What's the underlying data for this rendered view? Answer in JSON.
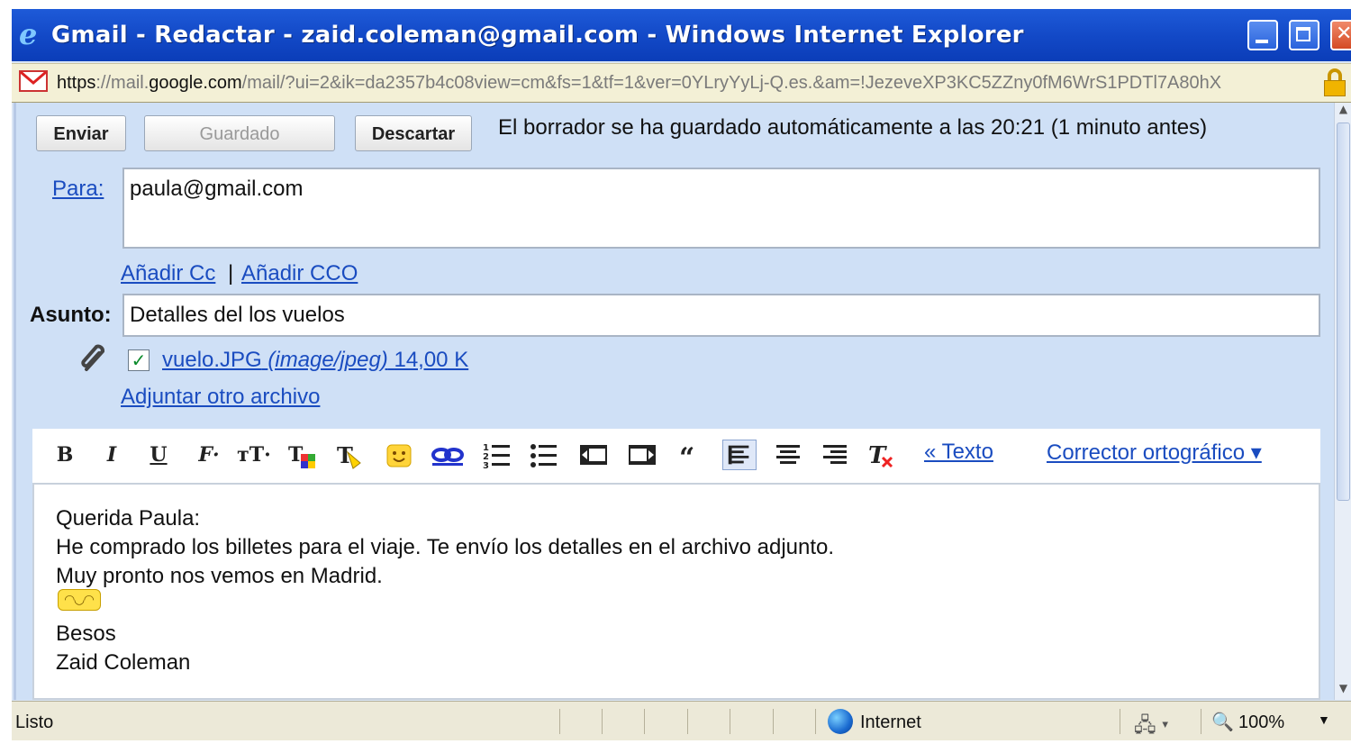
{
  "window": {
    "title": "Gmail - Redactar - zaid.coleman@gmail.com - Windows Internet Explorer",
    "icon": "ie-icon"
  },
  "address_bar": {
    "url_scheme": "https",
    "url_host_pre": "://mail.",
    "url_host_main": "google.com",
    "url_rest": "/mail/?ui=2&ik=da2357b4c08view=cm&fs=1&tf=1&ver=0YLryYyLj-Q.es.&am=!JezeveXP3KC5ZZny0fM6WrS1PDTl7A80hX"
  },
  "compose": {
    "send_label": "Enviar",
    "saved_label": "Guardado",
    "discard_label": "Descartar",
    "autosave_message": "El borrador se ha guardado automáticamente a las 20:21 (1 minuto antes)",
    "to_label": "Para:",
    "to_value": "paula@gmail.com",
    "add_cc": "Añadir Cc",
    "cc_separator": "|",
    "add_bcc": "Añadir CCO",
    "subject_label": "Asunto:",
    "subject_value": "Detalles del los vuelos",
    "attachment": {
      "checked": true,
      "name": "vuelo.JPG",
      "type": "(image/jpeg)",
      "size": "14,00 K"
    },
    "attach_another": "Adjuntar otro archivo"
  },
  "toolbar": {
    "bold": "B",
    "italic": "I",
    "underline": "U",
    "font": "F",
    "size": "тT",
    "plain_text_link": "« Texto",
    "spellcheck": "Corrector ortográfico ▾"
  },
  "body": {
    "lines": [
      "Querida Paula:",
      "He comprado los billetes para el viaje. Te envío los detalles en el archivo adjunto.",
      "Muy pronto nos vemos en Madrid.",
      "Besos",
      "Zaid Coleman"
    ]
  },
  "status_bar": {
    "status_text": "Listo",
    "zone": "Internet",
    "zoom": "100%"
  },
  "colors": {
    "titlebar": "#1248c6",
    "link": "#1a4cc0",
    "compose_bg": "#cfe0f6"
  }
}
